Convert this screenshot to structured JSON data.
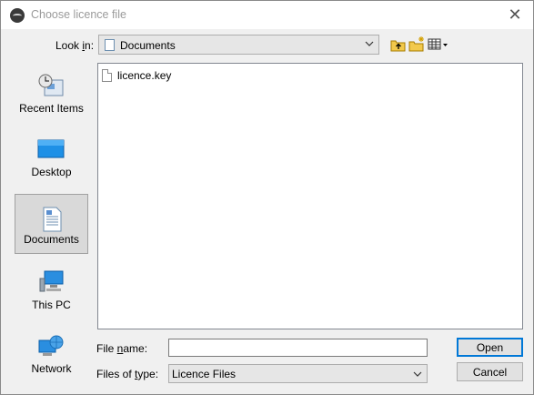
{
  "window": {
    "title": "Choose licence file"
  },
  "look_in": {
    "label_prefix": "Look ",
    "label_mnemonic": "i",
    "label_suffix": "n:",
    "value": "Documents"
  },
  "toolbar": {
    "icons": [
      "up-one-level-icon",
      "create-new-folder-icon",
      "view-menu-icon"
    ]
  },
  "places": [
    {
      "label": "Recent Items",
      "icon": "recent-items-icon",
      "selected": false
    },
    {
      "label": "Desktop",
      "icon": "desktop-icon",
      "selected": false
    },
    {
      "label": "Documents",
      "icon": "documents-icon",
      "selected": true
    },
    {
      "label": "This PC",
      "icon": "this-pc-icon",
      "selected": false
    },
    {
      "label": "Network",
      "icon": "network-icon",
      "selected": false
    }
  ],
  "files": [
    {
      "name": "licence.key",
      "icon": "file-icon"
    }
  ],
  "file_name": {
    "label_prefix": "File ",
    "label_mnemonic": "n",
    "label_suffix": "ame:",
    "value": ""
  },
  "files_of_type": {
    "label_prefix": "Files of ",
    "label_mnemonic": "t",
    "label_suffix": "ype:",
    "value": "Licence Files"
  },
  "buttons": {
    "open": "Open",
    "cancel": "Cancel"
  },
  "colors": {
    "accent": "#0078d7",
    "dialog_bg": "#f0f0f0"
  }
}
